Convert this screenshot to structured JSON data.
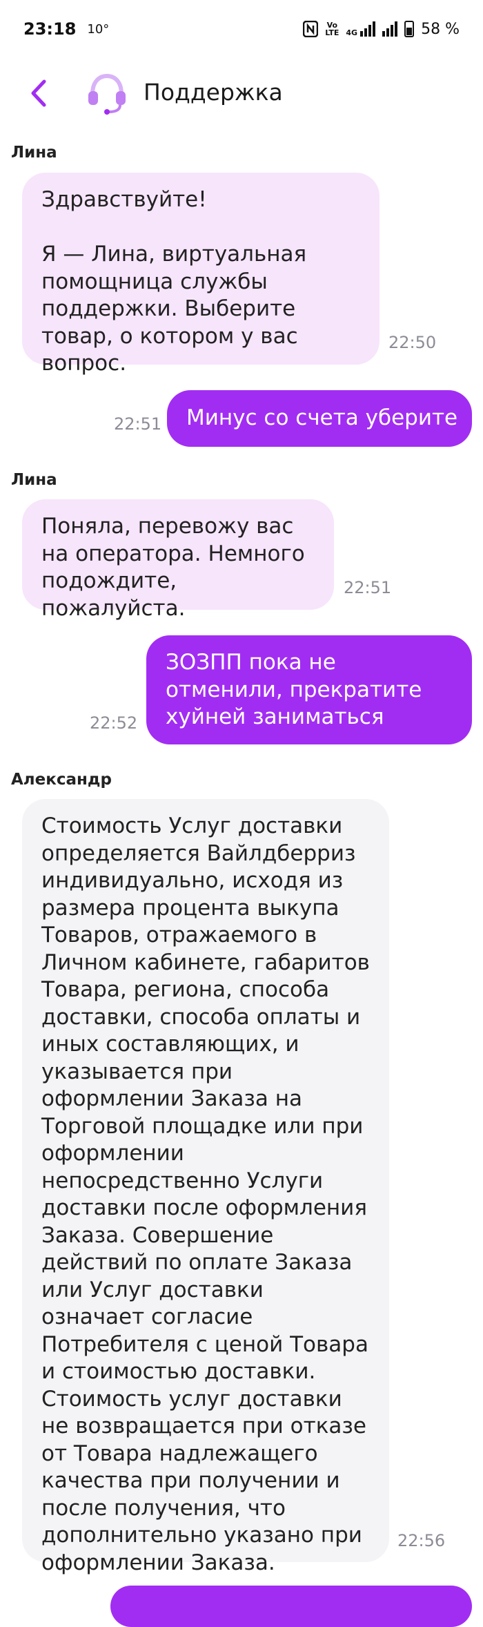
{
  "status_bar": {
    "time": "23:18",
    "temp": "10°",
    "network_top": "Vo",
    "network_bottom": "LTE",
    "data_type": "4G",
    "battery": "58 %"
  },
  "header": {
    "back_icon": "chevron-left-icon",
    "support_icon": "headset-icon",
    "title": "Поддержка"
  },
  "colors": {
    "accent": "#a22df2",
    "incoming_bubble": "#f7e5fc",
    "operator_bubble": "#f4f4f6"
  },
  "messages": [
    {
      "sender": "Лина",
      "text": "Здравствуйте!\n\nЯ — Лина, виртуальная помощница службы поддержки. Выберите товар, о котором у вас вопрос.",
      "time": "22:50",
      "direction": "in"
    },
    {
      "text": "Минус со счета уберите",
      "time": "22:51",
      "direction": "out"
    },
    {
      "sender": "Лина",
      "text": "Поняла, перевожу вас на оператора. Немного подождите, пожалуйста.",
      "time": "22:51",
      "direction": "in"
    },
    {
      "text": "ЗОЗПП пока не отменили, прекратите хуйней заниматься",
      "time": "22:52",
      "direction": "out"
    },
    {
      "sender": "Александр",
      "text": "Стоимость Услуг доставки определяется Вайлдберриз индивидуально, исходя из размера процента выкупа Товаров, отражаемого в Личном кабинете, габаритов Товара, региона, способа доставки, способа оплаты и иных составляющих, и указывается при оформлении Заказа на Торговой площадке или при оформлении непосредственно Услуги доставки после оформления Заказа. Совершение действий по оплате Заказа или Услуг доставки означает согласие Потребителя с ценой Товара и стоимостью доставки.\nСтоимость услуг доставки не возвращается при отказе от Товара надлежащего качества при получении и после получения, что дополнительно указано при оформлении Заказа.",
      "time": "22:56",
      "direction": "in"
    }
  ]
}
